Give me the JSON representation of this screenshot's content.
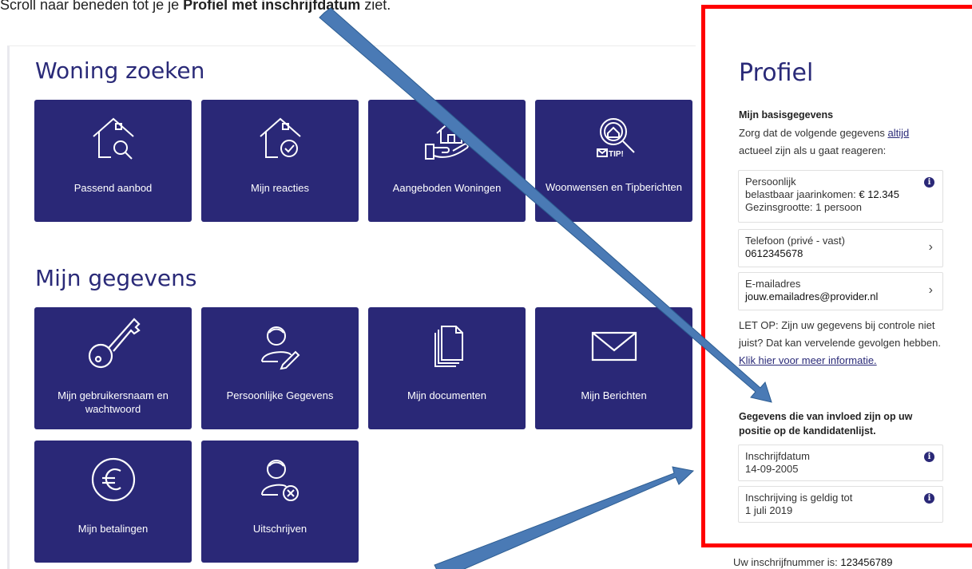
{
  "instruction": {
    "prefix": "Scroll naar beneden tot je je ",
    "bold": "Profiel met inschrijfdatum",
    "suffix": " ziet."
  },
  "woning": {
    "title": "Woning zoeken",
    "tiles": [
      {
        "label": "Passend aanbod",
        "icon": "house-search-icon"
      },
      {
        "label": "Mijn reacties",
        "icon": "house-check-icon"
      },
      {
        "label": "Aangeboden Woningen",
        "icon": "house-hand-icon"
      },
      {
        "label": "Woonwensen en Tipberichten",
        "icon": "magnifier-tip-icon",
        "tip": "TIP!"
      }
    ]
  },
  "gegevens": {
    "title": "Mijn gegevens",
    "tiles": [
      {
        "label": "Mijn gebruikersnaam en wachtwoord",
        "icon": "key-icon"
      },
      {
        "label": "Persoonlijke Gegevens",
        "icon": "person-edit-icon"
      },
      {
        "label": "Mijn documenten",
        "icon": "documents-icon"
      },
      {
        "label": "Mijn Berichten",
        "icon": "envelope-icon"
      },
      {
        "label": "Mijn betalingen",
        "icon": "euro-icon"
      },
      {
        "label": "Uitschrijven",
        "icon": "person-remove-icon"
      }
    ]
  },
  "profile": {
    "title": "Profiel",
    "basis_heading": "Mijn basisgegevens",
    "basis_intro_1": "Zorg dat de volgende gegevens ",
    "basis_intro_link": "altijd",
    "basis_intro_2": "actueel zijn als u gaat reageren:",
    "persoonlijk": {
      "label": "Persoonlijk",
      "line1_label": "belastbaar jaarinkomen: ",
      "line1_value": "€ 12.345",
      "line2": "Gezinsgrootte: 1 persoon"
    },
    "telefoon": {
      "label": "Telefoon (privé - vast)",
      "value": "0612345678"
    },
    "email": {
      "label": "E-mailadres",
      "value": "jouw.emailadres@provider.nl"
    },
    "warning_1": "LET OP: Zijn uw gegevens bij controle niet juist? Dat kan vervelende gevolgen hebben. ",
    "warning_link": "Klik hier voor meer informatie.",
    "positie_heading": "Gegevens die van invloed zijn op uw positie op de kandidatenlijst.",
    "inschrijfdatum": {
      "label": "Inschrijfdatum",
      "value": "14-09-2005"
    },
    "geldig": {
      "label": "Inschrijving is geldig tot",
      "value": "1 juli 2019"
    }
  },
  "footer": {
    "label": "Uw inschrijfnummer is: ",
    "value": "123456789"
  },
  "colors": {
    "tile_bg": "#2a2877",
    "heading": "#2a2a78",
    "highlight_border": "#ff0000",
    "arrow": "#4a7ab5"
  }
}
